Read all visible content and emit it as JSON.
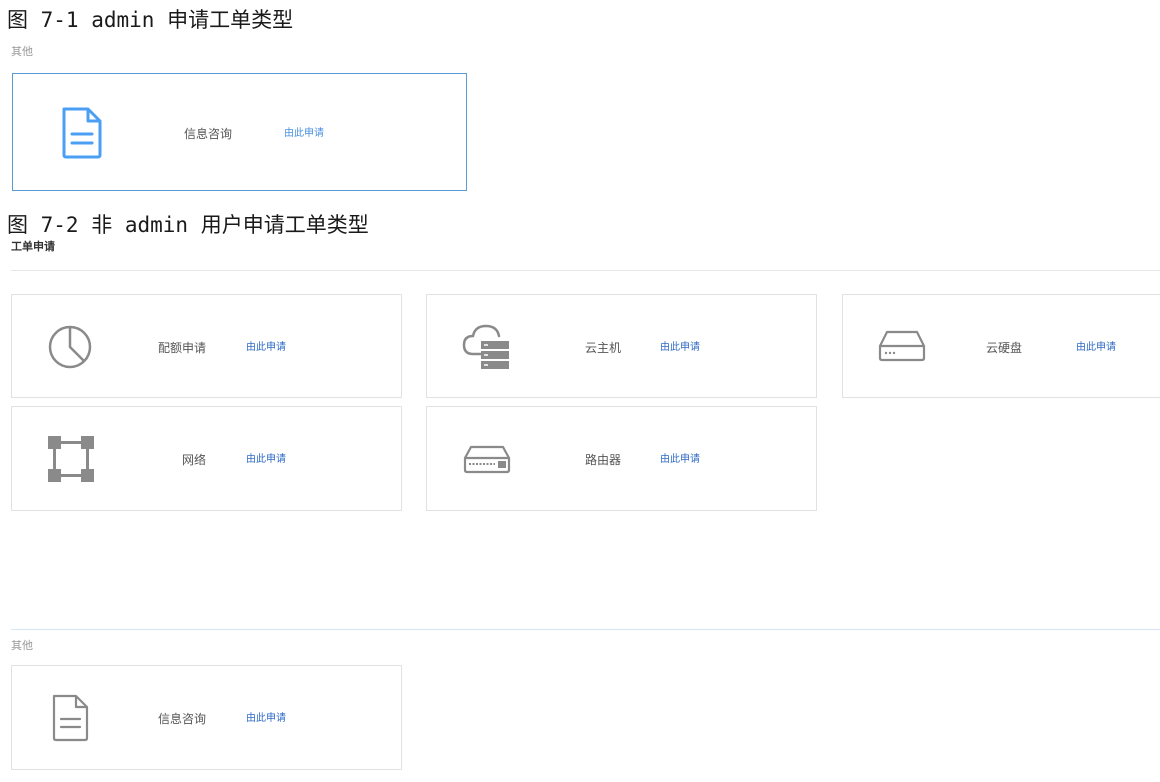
{
  "figure1": {
    "caption": "图 7-1 admin 申请工单类型",
    "section_label": "其他",
    "cards": [
      {
        "name": "信息咨询",
        "apply": "由此申请",
        "icon": "document-icon"
      }
    ],
    "accent_color": "#5b9bd5"
  },
  "figure2": {
    "caption": "图 7-2 非 admin 用户申请工单类型",
    "section_title": "工单申请",
    "cards": [
      {
        "name": "配额申请",
        "apply": "由此申请",
        "icon": "pie-chart-icon"
      },
      {
        "name": "云主机",
        "apply": "由此申请",
        "icon": "cloud-server-icon"
      },
      {
        "name": "云硬盘",
        "apply": "由此申请",
        "icon": "hard-disk-icon"
      },
      {
        "name": "网络",
        "apply": "由此申请",
        "icon": "network-topology-icon"
      },
      {
        "name": "路由器",
        "apply": "由此申请",
        "icon": "router-icon"
      }
    ],
    "other_label": "其他",
    "other_cards": [
      {
        "name": "信息咨询",
        "apply": "由此申请",
        "icon": "document-icon"
      }
    ],
    "link_color": "#2f6bc7",
    "icon_color": "#8a8a8a"
  }
}
